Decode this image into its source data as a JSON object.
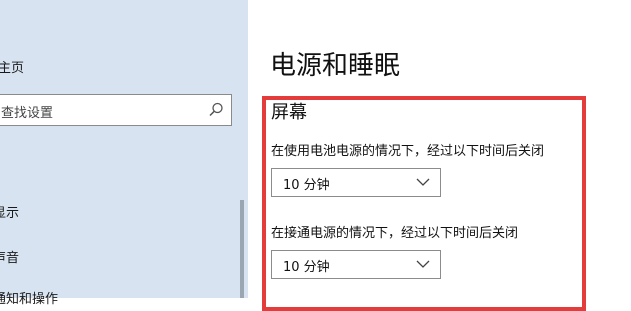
{
  "sidebar": {
    "home_label": "主页",
    "search": {
      "placeholder": "查找设置"
    },
    "items": [
      {
        "label": "显示"
      },
      {
        "label": "声音"
      },
      {
        "label": "通知和操作"
      }
    ]
  },
  "main": {
    "title": "电源和睡眠",
    "screen_section": {
      "title": "屏幕",
      "settings": [
        {
          "label": "在使用电池电源的情况下，经过以下时间后关闭",
          "value": "10 分钟"
        },
        {
          "label": "在接通电源的情况下，经过以下时间后关闭",
          "value": "10 分钟"
        }
      ]
    }
  },
  "colors": {
    "sidebar_bg": "#d7e3f0",
    "highlight": "#e43b3b"
  },
  "icons": [
    "search-icon",
    "chevron-down-icon"
  ]
}
